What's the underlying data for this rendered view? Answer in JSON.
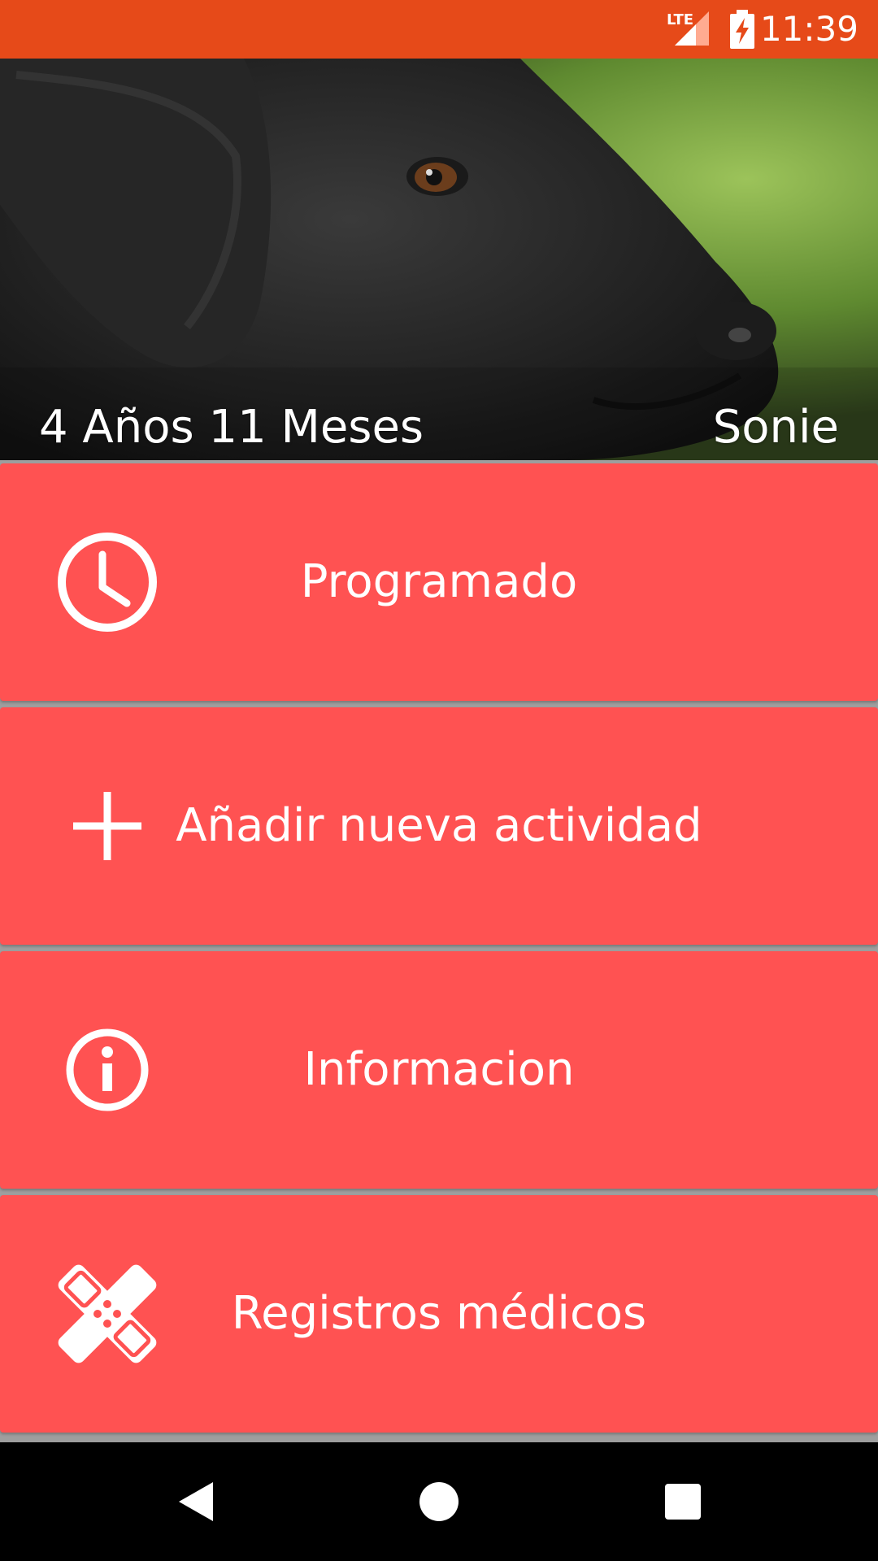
{
  "status_bar": {
    "time": "11:39",
    "network": "LTE",
    "icons": [
      "lte-signal-icon",
      "battery-charging-icon"
    ],
    "color": "#e64a19"
  },
  "header": {
    "age_text": "4 Años 11 Meses",
    "pet_name": "Sonie"
  },
  "menu": {
    "accent_color": "#ff5252",
    "items": [
      {
        "label": "Programado",
        "icon": "clock-icon"
      },
      {
        "label": "Añadir nueva actividad",
        "icon": "plus-icon"
      },
      {
        "label": "Informacion",
        "icon": "info-icon"
      },
      {
        "label": "Registros médicos",
        "icon": "bandage-icon"
      }
    ]
  },
  "nav_bar": {
    "buttons": [
      "back-icon",
      "home-icon",
      "recents-icon"
    ]
  }
}
